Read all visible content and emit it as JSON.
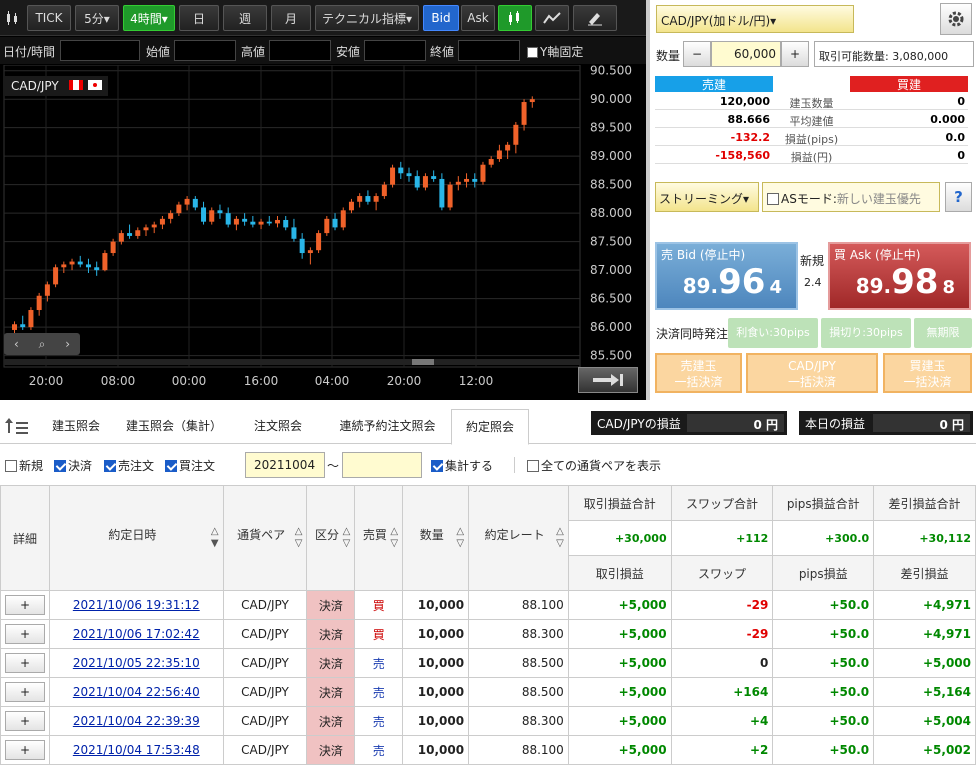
{
  "toolbar": {
    "items": [
      "TICK",
      "5分▾",
      "4時間▾",
      "日",
      "週",
      "月",
      "テクニカル指標▾",
      "Bid",
      "Ask"
    ]
  },
  "ohlc": {
    "labels": [
      "日付/時間",
      "始値",
      "高値",
      "安値",
      "終値"
    ],
    "y_fixed_label": "Y軸固定"
  },
  "chart": {
    "symbol": "CAD/JPY",
    "y_ticks": [
      "90.500",
      "90.000",
      "89.500",
      "89.000",
      "88.500",
      "88.000",
      "87.500",
      "87.000",
      "86.500",
      "86.000",
      "85.500"
    ],
    "x_ticks": [
      "20:00",
      "08:00",
      "00:00",
      "16:00",
      "04:00",
      "20:00",
      "12:00"
    ]
  },
  "chart_data": {
    "type": "candlestick",
    "title": "CAD/JPY",
    "ylim": [
      85.3,
      90.6
    ],
    "x_labels": [
      "20:00",
      "08:00",
      "00:00",
      "16:00",
      "04:00",
      "20:00",
      "12:00"
    ],
    "candles": [
      [
        85.95,
        86.1,
        85.8,
        86.05
      ],
      [
        86.05,
        86.2,
        85.95,
        86.0
      ],
      [
        86.0,
        86.35,
        85.95,
        86.3
      ],
      [
        86.3,
        86.6,
        86.2,
        86.55
      ],
      [
        86.55,
        86.8,
        86.45,
        86.75
      ],
      [
        86.75,
        87.1,
        86.7,
        87.05
      ],
      [
        87.05,
        87.15,
        86.95,
        87.1
      ],
      [
        87.1,
        87.2,
        87.0,
        87.15
      ],
      [
        87.15,
        87.25,
        87.05,
        87.1
      ],
      [
        87.1,
        87.2,
        86.95,
        87.05
      ],
      [
        87.05,
        87.15,
        86.9,
        87.0
      ],
      [
        87.0,
        87.35,
        86.98,
        87.3
      ],
      [
        87.3,
        87.55,
        87.25,
        87.5
      ],
      [
        87.5,
        87.7,
        87.45,
        87.65
      ],
      [
        87.65,
        87.8,
        87.55,
        87.6
      ],
      [
        87.6,
        87.75,
        87.55,
        87.7
      ],
      [
        87.7,
        87.8,
        87.6,
        87.75
      ],
      [
        87.75,
        87.85,
        87.65,
        87.8
      ],
      [
        87.8,
        87.95,
        87.72,
        87.9
      ],
      [
        87.9,
        88.05,
        87.82,
        88.0
      ],
      [
        88.0,
        88.2,
        87.95,
        88.15
      ],
      [
        88.15,
        88.3,
        88.05,
        88.25
      ],
      [
        88.25,
        88.3,
        88.05,
        88.1
      ],
      [
        88.1,
        88.2,
        87.8,
        87.85
      ],
      [
        87.85,
        88.1,
        87.8,
        88.05
      ],
      [
        88.05,
        88.15,
        87.9,
        88.0
      ],
      [
        88.0,
        88.1,
        87.75,
        87.8
      ],
      [
        87.8,
        87.95,
        87.7,
        87.9
      ],
      [
        87.9,
        88.0,
        87.78,
        87.85
      ],
      [
        87.85,
        87.95,
        87.75,
        87.8
      ],
      [
        87.8,
        87.9,
        87.72,
        87.85
      ],
      [
        87.85,
        87.95,
        87.78,
        87.82
      ],
      [
        87.82,
        87.95,
        87.75,
        87.88
      ],
      [
        87.88,
        87.95,
        87.7,
        87.75
      ],
      [
        87.75,
        87.9,
        87.5,
        87.55
      ],
      [
        87.55,
        87.65,
        87.2,
        87.3
      ],
      [
        87.3,
        87.4,
        87.1,
        87.35
      ],
      [
        87.35,
        87.7,
        87.3,
        87.65
      ],
      [
        87.65,
        87.95,
        87.6,
        87.9
      ],
      [
        87.9,
        88.0,
        87.7,
        87.75
      ],
      [
        87.75,
        88.1,
        87.7,
        88.05
      ],
      [
        88.05,
        88.25,
        88.0,
        88.2
      ],
      [
        88.2,
        88.35,
        88.1,
        88.3
      ],
      [
        88.3,
        88.4,
        88.15,
        88.2
      ],
      [
        88.2,
        88.35,
        88.05,
        88.3
      ],
      [
        88.3,
        88.55,
        88.25,
        88.5
      ],
      [
        88.5,
        88.85,
        88.45,
        88.8
      ],
      [
        88.8,
        88.9,
        88.6,
        88.7
      ],
      [
        88.7,
        88.8,
        88.55,
        88.65
      ],
      [
        88.65,
        88.75,
        88.4,
        88.45
      ],
      [
        88.45,
        88.7,
        88.4,
        88.65
      ],
      [
        88.65,
        88.75,
        88.55,
        88.6
      ],
      [
        88.6,
        88.7,
        88.05,
        88.1
      ],
      [
        88.1,
        88.55,
        88.05,
        88.5
      ],
      [
        88.5,
        88.65,
        88.4,
        88.55
      ],
      [
        88.55,
        88.7,
        88.45,
        88.6
      ],
      [
        88.6,
        88.7,
        88.45,
        88.55
      ],
      [
        88.55,
        88.9,
        88.5,
        88.85
      ],
      [
        88.85,
        89.0,
        88.8,
        88.95
      ],
      [
        88.95,
        89.2,
        88.9,
        89.1
      ],
      [
        89.1,
        89.25,
        88.95,
        89.2
      ],
      [
        89.2,
        89.6,
        89.05,
        89.55
      ],
      [
        89.55,
        90.0,
        89.45,
        89.95
      ],
      [
        89.95,
        90.05,
        89.85,
        90.0
      ]
    ]
  },
  "order_panel": {
    "pair_select": "CAD/JPY(加ドル/円)▾",
    "qty_label": "数量",
    "qty_minus": "−",
    "qty_value": "60,000",
    "qty_plus": "+",
    "available": "取引可能数量: 3,080,000",
    "sell_header": "売建",
    "buy_header": "買建",
    "rows": [
      {
        "sell": "120,000",
        "label": "建玉数量",
        "buy": "0"
      },
      {
        "sell": "88.666",
        "label": "平均建値",
        "buy": "0.000"
      },
      {
        "sell": "-132.2",
        "label": "損益(pips)",
        "buy": "0.0"
      },
      {
        "sell": "-158,560",
        "label": "損益(円)",
        "buy": "0"
      }
    ],
    "streaming": "ストリーミング▾",
    "as_mode": "ASモード:",
    "as_mode_value": "新しい建玉優先",
    "help": "?",
    "bid_label": "売 Bid (停止中)",
    "bid_big_prefix": "89.",
    "bid_big": "96",
    "bid_small": "4",
    "ask_label": "買 Ask (停止中)",
    "ask_big_prefix": "89.",
    "ask_big": "98",
    "ask_small": "8",
    "new_label": "新規",
    "spread": "2.4",
    "settle_label": "決済同時発注",
    "take_profit": "利食い:30pips",
    "stop_loss": "損切り:30pips",
    "unlimited": "無期限",
    "btn_sell_close_1": "売建玉",
    "btn_sell_close_2": "一括決済",
    "btn_all_close_1": "CAD/JPY",
    "btn_all_close_2": "一括決済",
    "btn_buy_close_1": "買建玉",
    "btn_buy_close_2": "一括決済"
  },
  "tabs": [
    "建玉照会",
    "建玉照会（集計）",
    "注文照会",
    "連続予約注文照会",
    "約定照会"
  ],
  "pl_boxes": {
    "pair_label": "CAD/JPYの損益",
    "pair_value": "0 円",
    "day_label": "本日の損益",
    "day_value": "0 円"
  },
  "filters": {
    "new": "新規",
    "settle": "決済",
    "sell": "売注文",
    "buy": "買注文",
    "date_from": "20211004",
    "tilde": "〜",
    "aggregate": "集計する",
    "all_pairs": "全ての通貨ペアを表示"
  },
  "table": {
    "headers": [
      "詳細",
      "約定日時",
      "通貨ペア",
      "区分",
      "売買",
      "数量",
      "約定レート"
    ],
    "sum_headers": [
      "取引損益合計",
      "スワップ合計",
      "pips損益合計",
      "差引損益合計"
    ],
    "sums": [
      "+30,000",
      "+112",
      "+300.0",
      "+30,112"
    ],
    "sub_headers": [
      "取引損益",
      "スワップ",
      "pips損益",
      "差引損益"
    ],
    "sort_up": "△",
    "sort_down": "▽",
    "sort_down_active": "▼",
    "rows": [
      {
        "detail": "+",
        "date": "2021/10/06 19:31:12",
        "pair": "CAD/JPY",
        "kind": "決済",
        "side": "買",
        "qty": "10,000",
        "rate": "88.100",
        "pl": "+5,000",
        "swap": "-29",
        "pips": "+50.0",
        "net": "+4,971"
      },
      {
        "detail": "+",
        "date": "2021/10/06 17:02:42",
        "pair": "CAD/JPY",
        "kind": "決済",
        "side": "買",
        "qty": "10,000",
        "rate": "88.300",
        "pl": "+5,000",
        "swap": "-29",
        "pips": "+50.0",
        "net": "+4,971"
      },
      {
        "detail": "+",
        "date": "2021/10/05 22:35:10",
        "pair": "CAD/JPY",
        "kind": "決済",
        "side": "売",
        "qty": "10,000",
        "rate": "88.500",
        "pl": "+5,000",
        "swap": "0",
        "pips": "+50.0",
        "net": "+5,000"
      },
      {
        "detail": "+",
        "date": "2021/10/04 22:56:40",
        "pair": "CAD/JPY",
        "kind": "決済",
        "side": "売",
        "qty": "10,000",
        "rate": "88.500",
        "pl": "+5,000",
        "swap": "+164",
        "pips": "+50.0",
        "net": "+5,164"
      },
      {
        "detail": "+",
        "date": "2021/10/04 22:39:39",
        "pair": "CAD/JPY",
        "kind": "決済",
        "side": "売",
        "qty": "10,000",
        "rate": "88.300",
        "pl": "+5,000",
        "swap": "+4",
        "pips": "+50.0",
        "net": "+5,004"
      },
      {
        "detail": "+",
        "date": "2021/10/04 17:53:48",
        "pair": "CAD/JPY",
        "kind": "決済",
        "side": "売",
        "qty": "10,000",
        "rate": "88.100",
        "pl": "+5,000",
        "swap": "+2",
        "pips": "+50.0",
        "net": "+5,002"
      }
    ]
  }
}
